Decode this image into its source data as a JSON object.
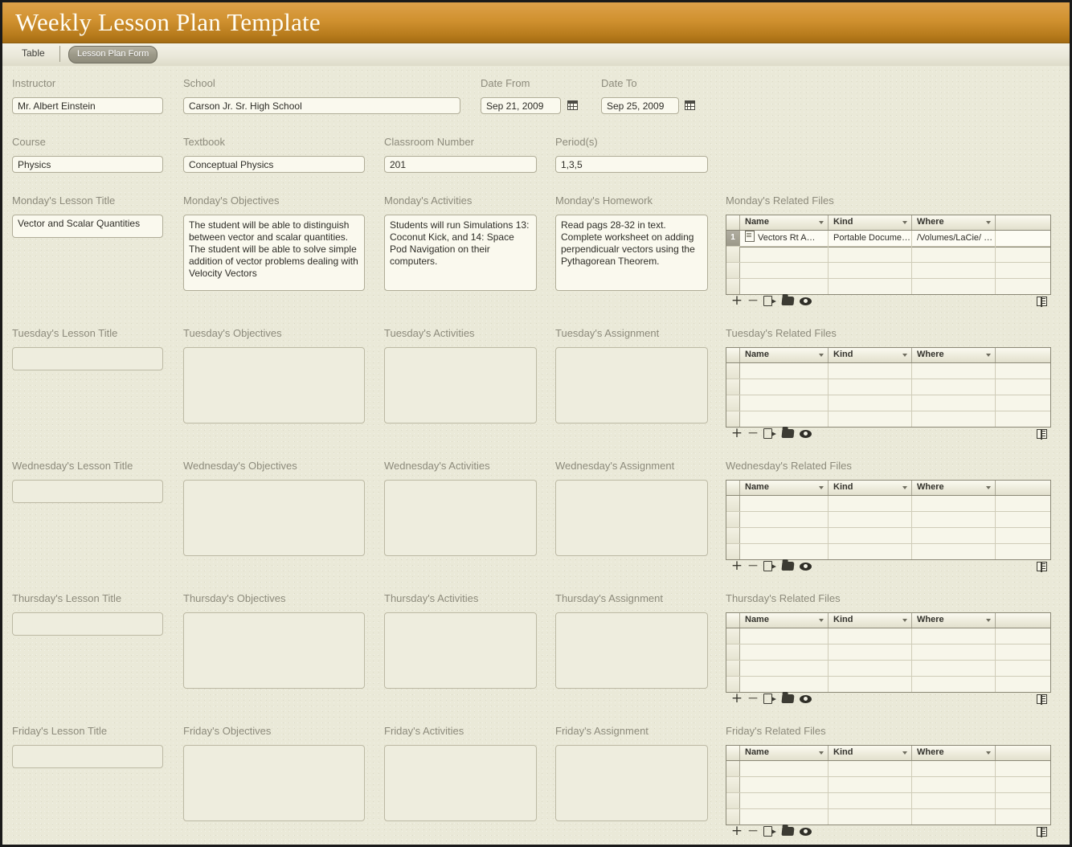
{
  "window": {
    "title": "Weekly Lesson Plan Template"
  },
  "tabbar": {
    "table_label": "Table",
    "form_label": "Lesson Plan Form"
  },
  "header_fields": {
    "instructor": {
      "label": "Instructor",
      "value": "Mr. Albert Einstein"
    },
    "school": {
      "label": "School",
      "value": "Carson Jr. Sr. High School"
    },
    "date_from": {
      "label": "Date From",
      "value": "Sep 21, 2009",
      "icon": "calendar-icon"
    },
    "date_to": {
      "label": "Date To",
      "value": "Sep 25, 2009",
      "icon": "calendar-icon"
    },
    "course": {
      "label": "Course",
      "value": "Physics"
    },
    "textbook": {
      "label": "Textbook",
      "value": "Conceptual Physics"
    },
    "classroom_number": {
      "label": "Classroom Number",
      "value": "201"
    },
    "periods": {
      "label": "Period(s)",
      "value": "1,3,5"
    }
  },
  "files_table": {
    "columns": [
      "Name",
      "Kind",
      "Where"
    ],
    "toolbar_icons": [
      "plus-icon",
      "minus-icon",
      "export-icon",
      "open-folder-icon",
      "preview-eye-icon",
      "grid-view-icon"
    ],
    "empty_row_count": 4
  },
  "days": [
    {
      "key": "monday",
      "title_label": "Monday's Lesson Title",
      "title_value": "Vector and Scalar Quantities",
      "objectives_label": "Monday's Objectives",
      "objectives_value": "The student will be able to distinguish between vector and scalar quantities. The student will be able to solve simple addition of vector problems dealing with Velocity Vectors",
      "activities_label": "Monday's Activities",
      "activities_value": "Students will run Simulations 13: Coconut Kick, and 14: Space Pod Navigation on their computers.",
      "fourth_label": "Monday's Homework",
      "fourth_value": "Read pags 28-32 in text. Complete worksheet on adding perpendicualr vectors using the Pythagorean Theorem.",
      "files_label": "Monday's Related Files",
      "files_rows": [
        {
          "num": "1",
          "name": "Vectors Rt A…",
          "kind": "Portable Docume…",
          "where": "/Volumes/LaCie/  …"
        }
      ]
    },
    {
      "key": "tuesday",
      "title_label": "Tuesday's Lesson Title",
      "title_value": "",
      "objectives_label": "Tuesday's Objectives",
      "objectives_value": "",
      "activities_label": "Tuesday's Activities",
      "activities_value": "",
      "fourth_label": "Tuesday's Assignment",
      "fourth_value": "",
      "files_label": "Tuesday's Related Files",
      "files_rows": []
    },
    {
      "key": "wednesday",
      "title_label": "Wednesday's Lesson Title",
      "title_value": "",
      "objectives_label": "Wednesday's Objectives",
      "objectives_value": "",
      "activities_label": "Wednesday's Activities",
      "activities_value": "",
      "fourth_label": "Wednesday's Assignment",
      "fourth_value": "",
      "files_label": "Wednesday's Related Files",
      "files_rows": []
    },
    {
      "key": "thursday",
      "title_label": "Thursday's Lesson Title",
      "title_value": "",
      "objectives_label": "Thursday's Objectives",
      "objectives_value": "",
      "activities_label": "Thursday's Activities",
      "activities_value": "",
      "fourth_label": "Thursday's Assignment",
      "fourth_value": "",
      "files_label": "Thursday's Related Files",
      "files_rows": []
    },
    {
      "key": "friday",
      "title_label": "Friday's Lesson Title",
      "title_value": "",
      "objectives_label": "Friday's Objectives",
      "objectives_value": "",
      "activities_label": "Friday's Activities",
      "activities_value": "",
      "fourth_label": "Friday's Assignment",
      "fourth_value": "",
      "files_label": "Friday's Related Files",
      "files_rows": []
    }
  ],
  "colors": {
    "titlebar_top": "#dda14a",
    "titlebar_bottom": "#a46c13",
    "page_background": "#eae9d8",
    "field_background": "#faf9ee",
    "label_text": "#8d8b7c"
  }
}
